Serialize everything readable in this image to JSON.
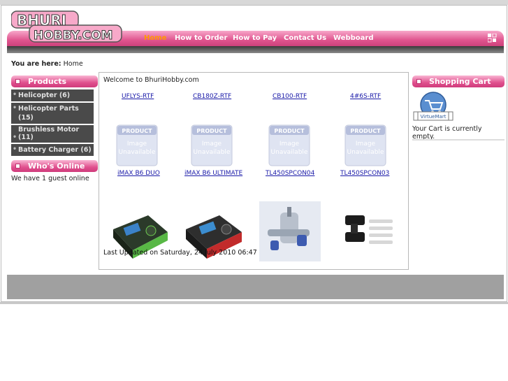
{
  "site": {
    "logo_line1": "BHURI",
    "logo_line2": "HOBBY.COM"
  },
  "nav": {
    "items": [
      "Home",
      "How to Order",
      "How to Pay",
      "Contact Us",
      "Webboard"
    ],
    "active_color": "#ff9a00"
  },
  "breadcrumb": {
    "label": "You are here:",
    "current": "Home"
  },
  "left": {
    "products_title": "Products",
    "products": [
      "Helicopter (6)",
      "Helicopter Parts (15)",
      "Brushless Motor (11)",
      "Battery Charger (6)"
    ],
    "whos_online_title": "Who's Online",
    "online_text": "We have 1 guest online"
  },
  "main": {
    "welcome": "Welcome to BhuriHobby.com",
    "row1_links": [
      "UFLYS-RTF",
      "CB180Z-RTF",
      "CB100-RTF",
      "4#6S-RTF"
    ],
    "placeholder_lines": [
      "PRODUCT",
      "Image",
      "Unavailable"
    ],
    "row2_links": [
      "iMAX B6 DUO",
      "iMAX B6 ULTIMATE",
      "TL450SPCON04",
      "TL450SPCON03"
    ],
    "updated": "Last Updated on Saturday, 24 July 2010 06:47"
  },
  "right": {
    "cart_title": "Shopping Cart",
    "cart_logo_text": "VirtueMart",
    "cart_empty": "Your Cart is currently empty."
  },
  "colors": {
    "brand_pink": "#e0508e",
    "menu_dark": "#4a4a4a",
    "link_blue": "#1a1aa8"
  }
}
